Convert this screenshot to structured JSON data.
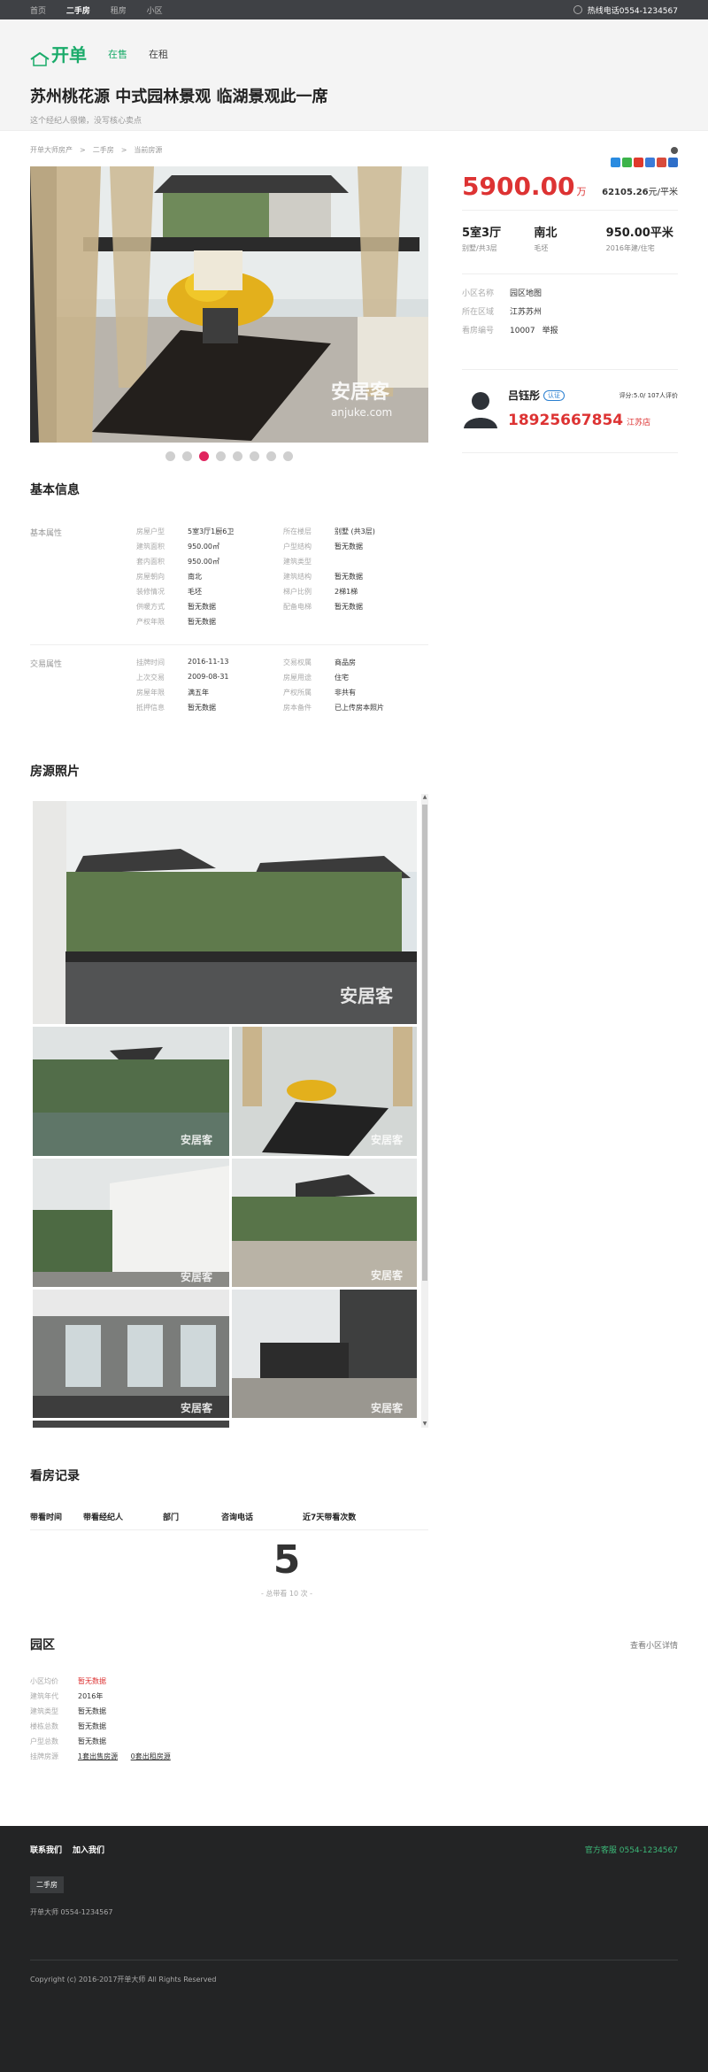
{
  "topbar": {
    "nav": [
      "首页",
      "二手房",
      "租房",
      "小区"
    ],
    "active_nav": "二手房",
    "hotline": "热线电话0554-1234567"
  },
  "header": {
    "logo_text": "开单",
    "tabs": [
      "在售",
      "在租"
    ],
    "title": "苏州桃花源 中式园林景观 临湖景观此一席",
    "subtitle": "这个经纪人很懒，没写核心卖点"
  },
  "breadcrumb": [
    "开单大师房产",
    "二手房",
    "当前房源"
  ],
  "listing": {
    "price": "5900.00",
    "price_unit": "万",
    "unit_price": "62105.26",
    "unit_price_suffix": "元/平米",
    "specs": [
      {
        "value": "5室3厅",
        "label": "别墅/共3层"
      },
      {
        "value": "南北",
        "label": "毛坯"
      },
      {
        "value": "950.00平米",
        "label": "2016年建/住宅"
      }
    ],
    "facts": [
      {
        "key": "小区名称",
        "values": [
          "园区",
          "地图"
        ]
      },
      {
        "key": "所在区域",
        "values": [
          "江苏",
          "苏州"
        ]
      },
      {
        "key": "看房编号",
        "values": [
          "10007",
          "举报"
        ]
      }
    ],
    "photo_dots": 8,
    "active_dot": 3
  },
  "agent": {
    "name": "吕钰彤",
    "badge": "认证",
    "score": "评分:5.0/ 107人评价",
    "phone": "18925667854",
    "store": "江苏店"
  },
  "basic_info": {
    "title": "基本信息",
    "groups": [
      {
        "head": "基本属性",
        "rows": [
          [
            "房屋户型",
            "5室3厅1厨6卫",
            "所在楼层",
            "别墅 (共3层)"
          ],
          [
            "建筑面积",
            "950.00㎡",
            "户型结构",
            "暂无数据"
          ],
          [
            "套内面积",
            "950.00㎡",
            "建筑类型",
            ""
          ],
          [
            "房屋朝向",
            "南北",
            "建筑结构",
            "暂无数据"
          ],
          [
            "装修情况",
            "毛坯",
            "梯户比例",
            "2梯1梯"
          ],
          [
            "供暖方式",
            "暂无数据",
            "配备电梯",
            "暂无数据"
          ],
          [
            "产权年限",
            "暂无数据",
            "",
            ""
          ]
        ]
      },
      {
        "head": "交易属性",
        "rows": [
          [
            "挂牌时间",
            "2016-11-13",
            "交易权属",
            "商品房"
          ],
          [
            "上次交易",
            "2009-08-31",
            "房屋用途",
            "住宅"
          ],
          [
            "房屋年限",
            "满五年",
            "产权所属",
            "非共有"
          ],
          [
            "抵押信息",
            "暂无数据",
            "房本备件",
            "已上传房本照片"
          ]
        ]
      }
    ]
  },
  "photos": {
    "title": "房源照片",
    "watermark": "安居客",
    "watermark_sub": "anjuke.com"
  },
  "visits": {
    "title": "看房记录",
    "headers": [
      "带看时间",
      "带看经纪人",
      "部门",
      "咨询电话",
      "近7天带看次数"
    ],
    "recent_count": "5",
    "total": "- 总带看 10 次 -"
  },
  "community": {
    "title": "园区",
    "more": "查看小区详情",
    "rows": [
      {
        "key": "小区均价",
        "value": "暂无数据",
        "red": true
      },
      {
        "key": "建筑年代",
        "value": "2016年"
      },
      {
        "key": "建筑类型",
        "value": "暂无数据"
      },
      {
        "key": "楼栋总数",
        "value": "暂无数据"
      },
      {
        "key": "户型总数",
        "value": "暂无数据"
      }
    ],
    "listing_key": "挂牌房源",
    "listing_links": [
      "1套出售房源",
      "0套出租房源"
    ]
  },
  "footer": {
    "links": [
      "联系我们",
      "加入我们"
    ],
    "service": "官方客服 0554-1234567",
    "button": "二手房",
    "phone": "开单大师 0554-1234567",
    "copyright": "Copyright (c) 2016-2017开单大师 All Rights Reserved"
  },
  "colors": {
    "accent_green": "#1aab6a",
    "price_red": "#dd3333",
    "dot_active": "#e0245e",
    "footer_bg": "#232425"
  }
}
